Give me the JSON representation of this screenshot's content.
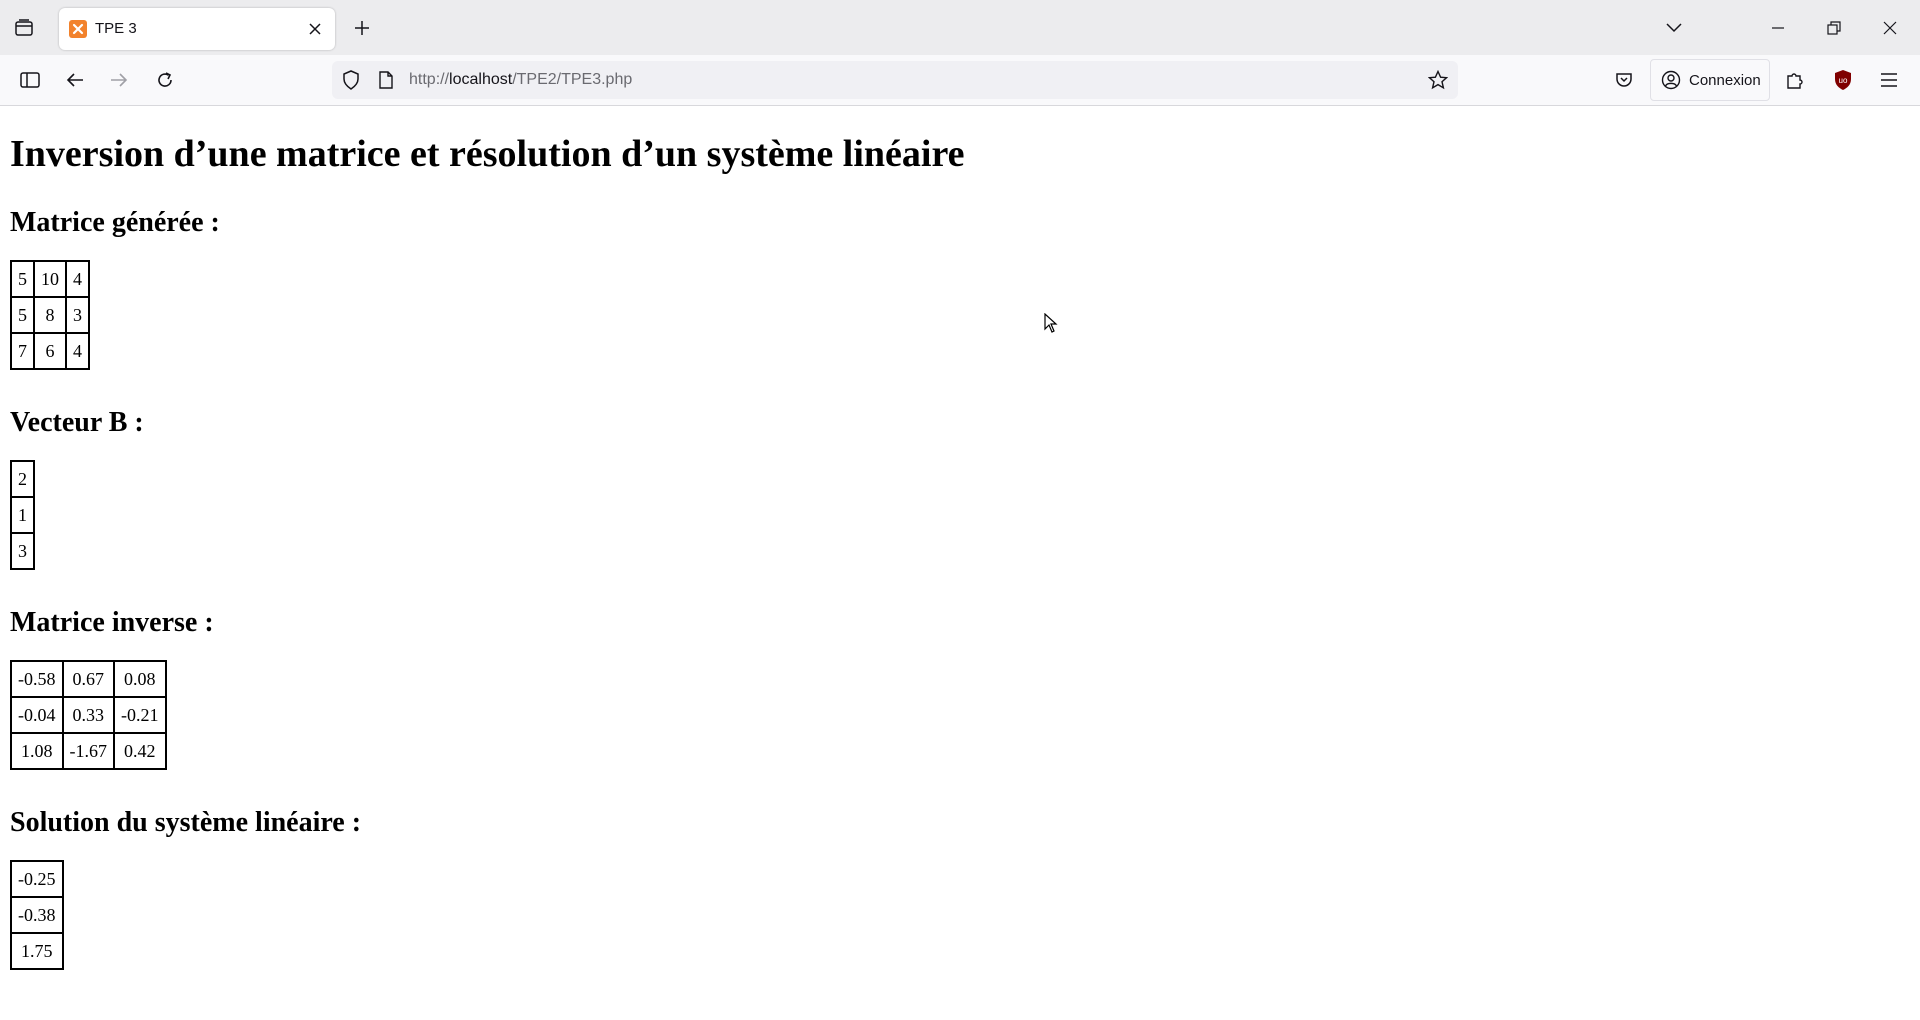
{
  "browser": {
    "tab_title": "TPE 3",
    "url_prefix": "http://",
    "url_host": "localhost",
    "url_path": "/TPE2/TPE3.php",
    "account_label": "Connexion",
    "favicon_color": "#f2822c",
    "extension_badge_color": "#800000"
  },
  "page": {
    "title": "Inversion d’une matrice et résolution d’un système linéaire",
    "matrix_heading": "Matrice générée :",
    "matrix": [
      [
        "5",
        "10",
        "4"
      ],
      [
        "5",
        "8",
        "3"
      ],
      [
        "7",
        "6",
        "4"
      ]
    ],
    "vector_heading": "Vecteur B :",
    "vector": [
      [
        "2"
      ],
      [
        "1"
      ],
      [
        "3"
      ]
    ],
    "inverse_heading": "Matrice inverse :",
    "inverse": [
      [
        "-0.58",
        "0.67",
        "0.08"
      ],
      [
        "-0.04",
        "0.33",
        "-0.21"
      ],
      [
        "1.08",
        "-1.67",
        "0.42"
      ]
    ],
    "solution_heading": "Solution du système linéaire :",
    "solution": [
      [
        "-0.25"
      ],
      [
        "-0.38"
      ],
      [
        "1.75"
      ]
    ]
  }
}
